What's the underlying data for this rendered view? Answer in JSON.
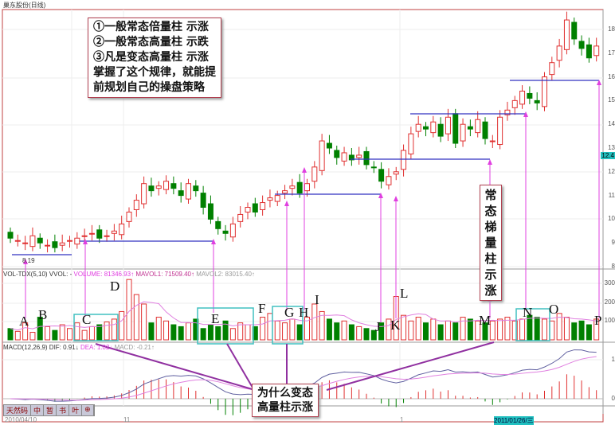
{
  "title": "巢东股份(日线)",
  "price_axis": [
    18,
    17,
    16,
    15,
    14,
    13,
    12,
    11,
    10,
    9,
    8
  ],
  "last_price": "12.4",
  "low_label": "8.19",
  "vol_header": {
    "name": "VOL-TDX(5,10) VVOL: -",
    "volume": "VOLUME: 81346.93↑",
    "mavol1": "MAVOL1: 71509.40↑",
    "mavol2": "MAVOL2: 83015.40↑"
  },
  "vol_axis": [
    300,
    200,
    100
  ],
  "macd_header": {
    "name": "MACD(12,26,9) DIF: 0.91↓",
    "dea": "DEA: 1.02↓",
    "macd": "MACD: -0.21↑"
  },
  "macd_axis": [
    1,
    0
  ],
  "dates": {
    "start": "2010/04/10",
    "m1": "11",
    "m2": "1",
    "cursor": "2011/01/26/三"
  },
  "toolbar": [
    "天然码",
    "中",
    "暂",
    "书",
    "叶",
    "⊕"
  ],
  "note_main": [
    "①一般常态倍量柱 示涨",
    "②一般常态高量柱 示跌",
    "③凡是变态高量柱 示涨",
    "掌握了这个规律，就能提",
    "前规划自己的操盘策略"
  ],
  "note_vertical": "常态梯量柱示涨",
  "note_bottom": [
    "为什么变态",
    "高量柱示涨"
  ],
  "letters": [
    "A",
    "B",
    "C",
    "D",
    "E",
    "F",
    "G",
    "H",
    "I",
    "J",
    "K",
    "L",
    "M",
    "N",
    "O",
    "P"
  ],
  "colors": {
    "up": "#e03030",
    "down": "#008000",
    "support": "#3030c0",
    "arrow": "#e040e0",
    "box": "#40c0c0"
  },
  "chart_data": {
    "type": "candlestick",
    "closes": [
      9.2,
      9.1,
      9.0,
      9.3,
      9.0,
      8.9,
      8.8,
      9.0,
      9.1,
      9.2,
      9.3,
      9.4,
      9.2,
      9.3,
      9.5,
      9.8,
      10.3,
      10.8,
      11.5,
      11.2,
      11.4,
      11.6,
      11.3,
      11.0,
      11.5,
      11.2,
      10.5,
      10.0,
      9.6,
      9.4,
      9.8,
      10.2,
      10.5,
      10.3,
      10.7,
      10.9,
      11.0,
      11.2,
      11.4,
      11.1,
      11.5,
      12.2,
      13.3,
      13.0,
      12.6,
      12.8,
      12.5,
      12.7,
      12.3,
      12.2,
      11.6,
      11.8,
      12.0,
      12.9,
      13.6,
      14.0,
      13.8,
      14.1,
      13.5,
      14.3,
      13.2,
      14.0,
      13.8,
      14.2,
      13.4,
      13.3,
      14.3,
      14.6,
      15.0,
      15.4,
      15.1,
      14.9,
      16.0,
      16.6,
      17.3,
      18.4,
      17.6,
      17.2,
      16.8,
      17.3
    ],
    "volumes": [
      60,
      45,
      90,
      40,
      120,
      70,
      50,
      80,
      60,
      90,
      50,
      70,
      80,
      95,
      110,
      150,
      320,
      240,
      190,
      90,
      120,
      100,
      80,
      70,
      90,
      110,
      60,
      80,
      70,
      100,
      60,
      90,
      80,
      70,
      120,
      140,
      100,
      90,
      110,
      80,
      120,
      190,
      150,
      110,
      90,
      100,
      80,
      70,
      60,
      50,
      90,
      110,
      230,
      130,
      100,
      120,
      90,
      110,
      80,
      100,
      90,
      120,
      110,
      100,
      90,
      100,
      110,
      120,
      100,
      110,
      130,
      120,
      110,
      100,
      140,
      120,
      90,
      100,
      80,
      110
    ],
    "ylim": [
      8,
      18.5
    ]
  }
}
